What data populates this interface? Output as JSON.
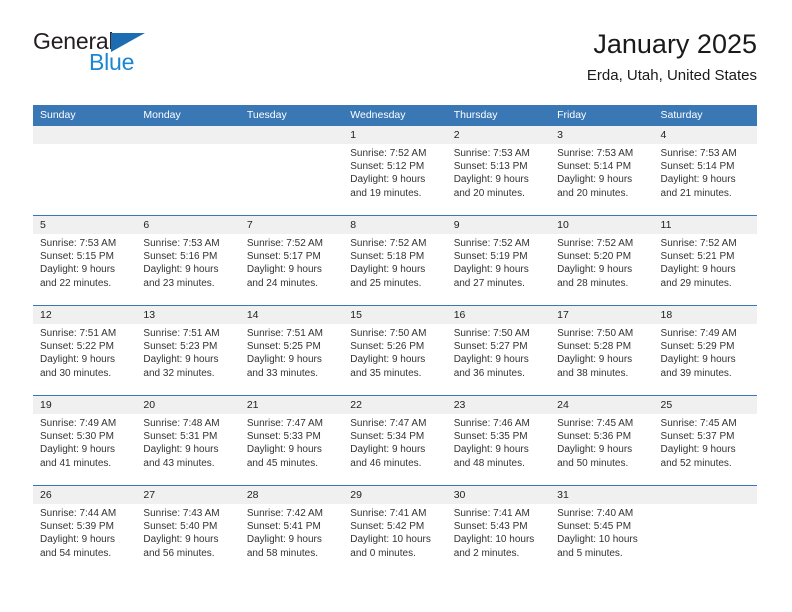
{
  "brand": {
    "name_top": "General",
    "name_bottom": "Blue",
    "triangle_icon": "brand-triangle-icon",
    "accent_color": "#1b87d4",
    "dark_color": "#231f20"
  },
  "header": {
    "title": "January 2025",
    "subtitle": "Erda, Utah, United States"
  },
  "calendar": {
    "header_color": "#3a78b5",
    "daynum_band_color": "#f0f0f0",
    "weekdays": [
      "Sunday",
      "Monday",
      "Tuesday",
      "Wednesday",
      "Thursday",
      "Friday",
      "Saturday"
    ],
    "weeks": [
      {
        "days": [
          {
            "num": "",
            "lines": []
          },
          {
            "num": "",
            "lines": []
          },
          {
            "num": "",
            "lines": []
          },
          {
            "num": "1",
            "lines": [
              "Sunrise: 7:52 AM",
              "Sunset: 5:12 PM",
              "Daylight: 9 hours",
              "and 19 minutes."
            ]
          },
          {
            "num": "2",
            "lines": [
              "Sunrise: 7:53 AM",
              "Sunset: 5:13 PM",
              "Daylight: 9 hours",
              "and 20 minutes."
            ]
          },
          {
            "num": "3",
            "lines": [
              "Sunrise: 7:53 AM",
              "Sunset: 5:14 PM",
              "Daylight: 9 hours",
              "and 20 minutes."
            ]
          },
          {
            "num": "4",
            "lines": [
              "Sunrise: 7:53 AM",
              "Sunset: 5:14 PM",
              "Daylight: 9 hours",
              "and 21 minutes."
            ]
          }
        ]
      },
      {
        "days": [
          {
            "num": "5",
            "lines": [
              "Sunrise: 7:53 AM",
              "Sunset: 5:15 PM",
              "Daylight: 9 hours",
              "and 22 minutes."
            ]
          },
          {
            "num": "6",
            "lines": [
              "Sunrise: 7:53 AM",
              "Sunset: 5:16 PM",
              "Daylight: 9 hours",
              "and 23 minutes."
            ]
          },
          {
            "num": "7",
            "lines": [
              "Sunrise: 7:52 AM",
              "Sunset: 5:17 PM",
              "Daylight: 9 hours",
              "and 24 minutes."
            ]
          },
          {
            "num": "8",
            "lines": [
              "Sunrise: 7:52 AM",
              "Sunset: 5:18 PM",
              "Daylight: 9 hours",
              "and 25 minutes."
            ]
          },
          {
            "num": "9",
            "lines": [
              "Sunrise: 7:52 AM",
              "Sunset: 5:19 PM",
              "Daylight: 9 hours",
              "and 27 minutes."
            ]
          },
          {
            "num": "10",
            "lines": [
              "Sunrise: 7:52 AM",
              "Sunset: 5:20 PM",
              "Daylight: 9 hours",
              "and 28 minutes."
            ]
          },
          {
            "num": "11",
            "lines": [
              "Sunrise: 7:52 AM",
              "Sunset: 5:21 PM",
              "Daylight: 9 hours",
              "and 29 minutes."
            ]
          }
        ]
      },
      {
        "days": [
          {
            "num": "12",
            "lines": [
              "Sunrise: 7:51 AM",
              "Sunset: 5:22 PM",
              "Daylight: 9 hours",
              "and 30 minutes."
            ]
          },
          {
            "num": "13",
            "lines": [
              "Sunrise: 7:51 AM",
              "Sunset: 5:23 PM",
              "Daylight: 9 hours",
              "and 32 minutes."
            ]
          },
          {
            "num": "14",
            "lines": [
              "Sunrise: 7:51 AM",
              "Sunset: 5:25 PM",
              "Daylight: 9 hours",
              "and 33 minutes."
            ]
          },
          {
            "num": "15",
            "lines": [
              "Sunrise: 7:50 AM",
              "Sunset: 5:26 PM",
              "Daylight: 9 hours",
              "and 35 minutes."
            ]
          },
          {
            "num": "16",
            "lines": [
              "Sunrise: 7:50 AM",
              "Sunset: 5:27 PM",
              "Daylight: 9 hours",
              "and 36 minutes."
            ]
          },
          {
            "num": "17",
            "lines": [
              "Sunrise: 7:50 AM",
              "Sunset: 5:28 PM",
              "Daylight: 9 hours",
              "and 38 minutes."
            ]
          },
          {
            "num": "18",
            "lines": [
              "Sunrise: 7:49 AM",
              "Sunset: 5:29 PM",
              "Daylight: 9 hours",
              "and 39 minutes."
            ]
          }
        ]
      },
      {
        "days": [
          {
            "num": "19",
            "lines": [
              "Sunrise: 7:49 AM",
              "Sunset: 5:30 PM",
              "Daylight: 9 hours",
              "and 41 minutes."
            ]
          },
          {
            "num": "20",
            "lines": [
              "Sunrise: 7:48 AM",
              "Sunset: 5:31 PM",
              "Daylight: 9 hours",
              "and 43 minutes."
            ]
          },
          {
            "num": "21",
            "lines": [
              "Sunrise: 7:47 AM",
              "Sunset: 5:33 PM",
              "Daylight: 9 hours",
              "and 45 minutes."
            ]
          },
          {
            "num": "22",
            "lines": [
              "Sunrise: 7:47 AM",
              "Sunset: 5:34 PM",
              "Daylight: 9 hours",
              "and 46 minutes."
            ]
          },
          {
            "num": "23",
            "lines": [
              "Sunrise: 7:46 AM",
              "Sunset: 5:35 PM",
              "Daylight: 9 hours",
              "and 48 minutes."
            ]
          },
          {
            "num": "24",
            "lines": [
              "Sunrise: 7:45 AM",
              "Sunset: 5:36 PM",
              "Daylight: 9 hours",
              "and 50 minutes."
            ]
          },
          {
            "num": "25",
            "lines": [
              "Sunrise: 7:45 AM",
              "Sunset: 5:37 PM",
              "Daylight: 9 hours",
              "and 52 minutes."
            ]
          }
        ]
      },
      {
        "days": [
          {
            "num": "26",
            "lines": [
              "Sunrise: 7:44 AM",
              "Sunset: 5:39 PM",
              "Daylight: 9 hours",
              "and 54 minutes."
            ]
          },
          {
            "num": "27",
            "lines": [
              "Sunrise: 7:43 AM",
              "Sunset: 5:40 PM",
              "Daylight: 9 hours",
              "and 56 minutes."
            ]
          },
          {
            "num": "28",
            "lines": [
              "Sunrise: 7:42 AM",
              "Sunset: 5:41 PM",
              "Daylight: 9 hours",
              "and 58 minutes."
            ]
          },
          {
            "num": "29",
            "lines": [
              "Sunrise: 7:41 AM",
              "Sunset: 5:42 PM",
              "Daylight: 10 hours",
              "and 0 minutes."
            ]
          },
          {
            "num": "30",
            "lines": [
              "Sunrise: 7:41 AM",
              "Sunset: 5:43 PM",
              "Daylight: 10 hours",
              "and 2 minutes."
            ]
          },
          {
            "num": "31",
            "lines": [
              "Sunrise: 7:40 AM",
              "Sunset: 5:45 PM",
              "Daylight: 10 hours",
              "and 5 minutes."
            ]
          },
          {
            "num": "",
            "lines": []
          }
        ]
      }
    ]
  }
}
